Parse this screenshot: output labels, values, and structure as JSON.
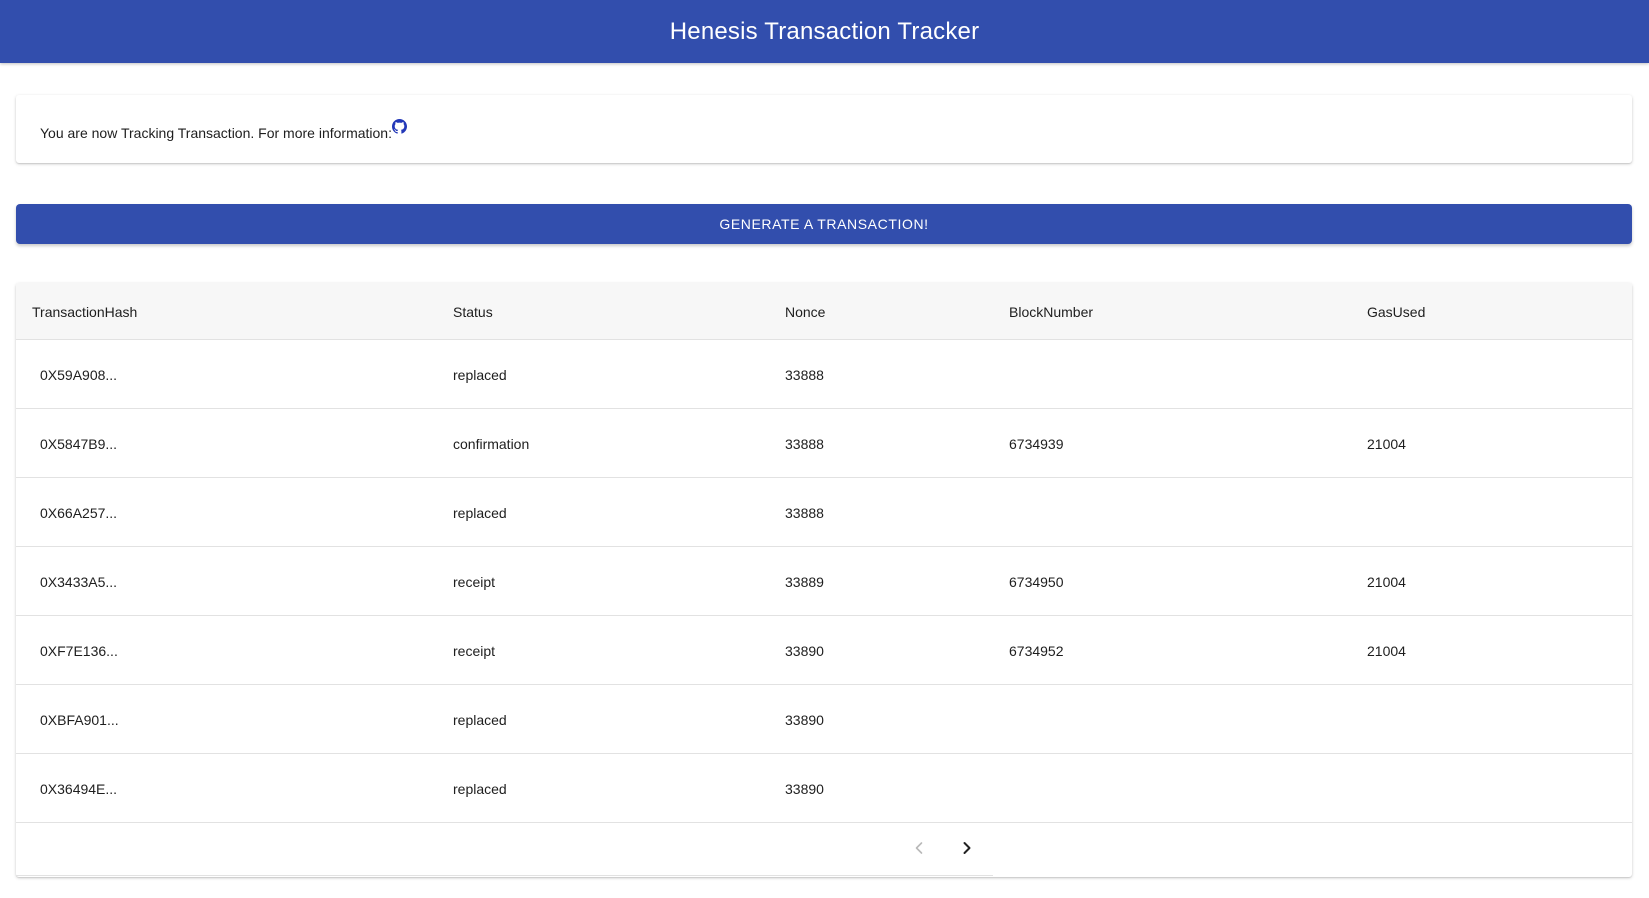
{
  "app": {
    "title": "Henesis Transaction Tracker",
    "accent_color": "#324ead"
  },
  "info": {
    "text": "You are now Tracking Transaction. For more information:",
    "link_icon": "github-icon"
  },
  "actions": {
    "generate_label": "GENERATE A TRANSACTION!"
  },
  "table": {
    "columns": [
      "TransactionHash",
      "Status",
      "Nonce",
      "BlockNumber",
      "GasUsed"
    ],
    "rows": [
      {
        "hash": "0X59A908...",
        "status": "replaced",
        "nonce": "33888",
        "block": "",
        "gas": ""
      },
      {
        "hash": "0X5847B9...",
        "status": "confirmation",
        "nonce": "33888",
        "block": "6734939",
        "gas": "21004"
      },
      {
        "hash": "0X66A257...",
        "status": "replaced",
        "nonce": "33888",
        "block": "",
        "gas": ""
      },
      {
        "hash": "0X3433A5...",
        "status": "receipt",
        "nonce": "33889",
        "block": "6734950",
        "gas": "21004"
      },
      {
        "hash": "0XF7E136...",
        "status": "receipt",
        "nonce": "33890",
        "block": "6734952",
        "gas": "21004"
      },
      {
        "hash": "0XBFA901...",
        "status": "replaced",
        "nonce": "33890",
        "block": "",
        "gas": ""
      },
      {
        "hash": "0X36494E...",
        "status": "replaced",
        "nonce": "33890",
        "block": "",
        "gas": ""
      }
    ]
  },
  "pagination": {
    "prev_icon": "chevron-left-icon",
    "next_icon": "chevron-right-icon",
    "prev_enabled": false,
    "next_enabled": true
  }
}
